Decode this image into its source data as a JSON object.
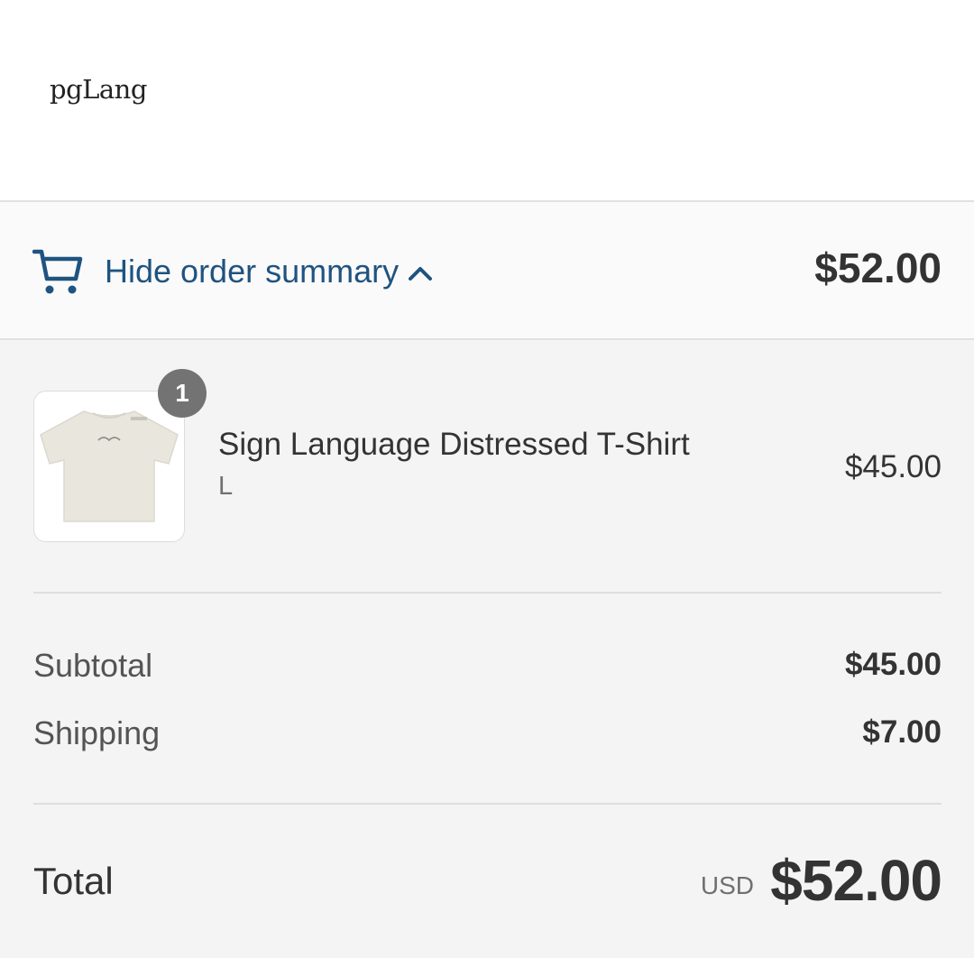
{
  "brand": {
    "logo_text": "pgLang"
  },
  "summary_bar": {
    "toggle_label": "Hide order summary",
    "icon": "cart-icon",
    "chevron": "chevron-up-icon",
    "total": "$52.00",
    "link_color": "#1f5380"
  },
  "line_items": [
    {
      "quantity": "1",
      "name": "Sign Language Distressed T-Shirt",
      "variant": "L",
      "price": "$45.00",
      "image": "t-shirt-thumbnail"
    }
  ],
  "totals": {
    "subtotal_label": "Subtotal",
    "subtotal_value": "$45.00",
    "shipping_label": "Shipping",
    "shipping_value": "$7.00",
    "total_label": "Total",
    "currency": "USD",
    "total_value": "$52.00"
  }
}
